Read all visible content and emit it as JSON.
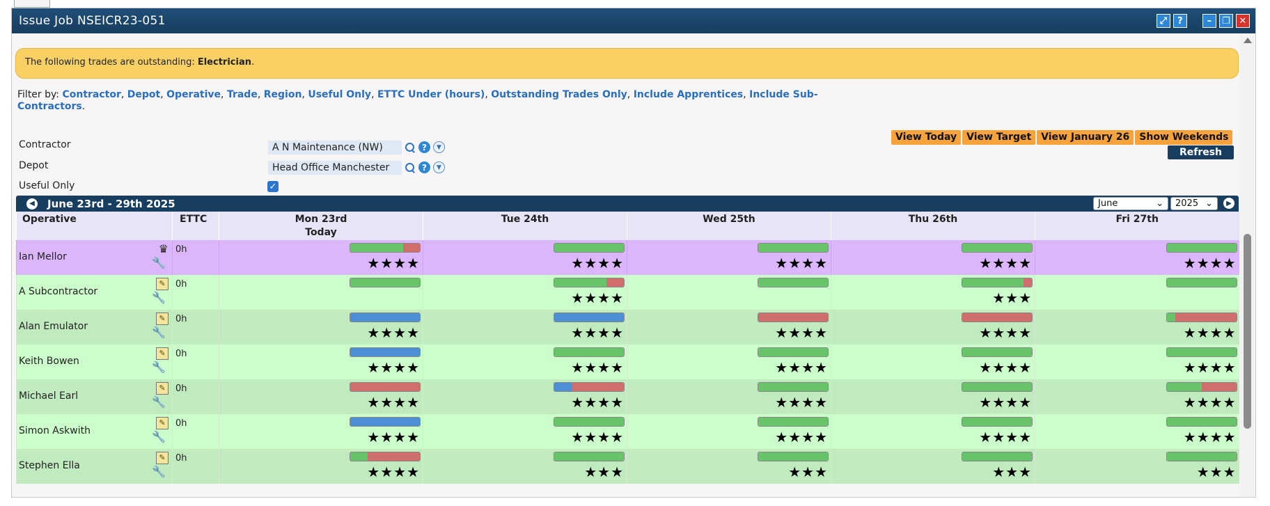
{
  "window": {
    "title": "Issue Job NSEICR23-051",
    "icons": [
      "resize-icon",
      "help-icon",
      "minimize-icon",
      "restore-icon",
      "close-icon"
    ]
  },
  "notice": {
    "prefix": "The following trades are outstanding: ",
    "trade": "Electrician",
    "suffix": "."
  },
  "filter": {
    "label": "Filter by: ",
    "links": [
      "Contractor",
      "Depot",
      "Operative",
      "Trade",
      "Region",
      "Useful Only",
      "ETTC Under (hours)",
      "Outstanding Trades Only",
      "Include Apprentices",
      "Include Sub-Contractors"
    ],
    "end": "."
  },
  "form": {
    "contractor_label": "Contractor",
    "contractor_value": "A N Maintenance (NW)",
    "depot_label": "Depot",
    "depot_value": "Head Office Manchester",
    "useful_label": "Useful Only",
    "useful_checked": true
  },
  "buttons": {
    "view_today": "View Today",
    "view_target": "View Target",
    "view_month": "View January 26",
    "show_weekends": "Show Weekends",
    "refresh": "Refresh"
  },
  "calendar": {
    "range": "June 23rd - 29th 2025",
    "month_select": "June",
    "year_select": "2025",
    "col_operative": "Operative",
    "col_ettc": "ETTC",
    "days": [
      "Mon 23rd",
      "Tue 24th",
      "Wed 25th",
      "Thu 26th",
      "Fri 27th"
    ],
    "today_label": "Today",
    "today_index": 0
  },
  "colors": {
    "green": "#67c46b",
    "blue": "#4d8fd4",
    "red": "#cf6e6a",
    "purple_row": "#dcb6fa",
    "green_row": "#ccfecb"
  },
  "operatives": [
    {
      "name": "Ian Mellor",
      "ettc": "0h",
      "icon": "crown-icon",
      "wrench": "orange",
      "rowclass": "purple",
      "days": [
        {
          "bar": [
            [
              "g",
              76
            ],
            [
              "r",
              24
            ]
          ],
          "stars": "★★★★"
        },
        {
          "bar": [
            [
              "g",
              100
            ]
          ],
          "stars": "★★★★"
        },
        {
          "bar": [
            [
              "g",
              100
            ]
          ],
          "stars": "★★★★"
        },
        {
          "bar": [
            [
              "g",
              100
            ]
          ],
          "stars": "★★★★"
        },
        {
          "bar": [
            [
              "g",
              100
            ]
          ],
          "stars": "★★★★"
        }
      ]
    },
    {
      "name": "A Subcontractor",
      "ettc": "0h",
      "icon": "document-icon",
      "wrench": "blue",
      "rowclass": "g1",
      "days": [
        {
          "bar": [
            [
              "g",
              100
            ]
          ],
          "stars": ""
        },
        {
          "bar": [
            [
              "g",
              75
            ],
            [
              "r",
              25
            ]
          ],
          "stars": "★★★★"
        },
        {
          "bar": [
            [
              "g",
              100
            ]
          ],
          "stars": ""
        },
        {
          "bar": [
            [
              "g",
              88
            ],
            [
              "r",
              12
            ]
          ],
          "stars": "★★★"
        },
        {
          "bar": [
            [
              "g",
              100
            ]
          ],
          "stars": ""
        }
      ]
    },
    {
      "name": "Alan Emulator",
      "ettc": "0h",
      "icon": "document-icon",
      "wrench": "blue",
      "rowclass": "g2",
      "days": [
        {
          "bar": [
            [
              "b",
              100
            ]
          ],
          "stars": "★★★★"
        },
        {
          "bar": [
            [
              "b",
              100
            ]
          ],
          "stars": "★★★★"
        },
        {
          "bar": [
            [
              "r",
              100
            ]
          ],
          "stars": "★★★★"
        },
        {
          "bar": [
            [
              "r",
              100
            ]
          ],
          "stars": "★★★★"
        },
        {
          "bar": [
            [
              "g",
              12
            ],
            [
              "r",
              88
            ]
          ],
          "stars": "★★★★"
        }
      ]
    },
    {
      "name": "Keith Bowen",
      "ettc": "0h",
      "icon": "document-icon",
      "wrench": "blue",
      "rowclass": "g1",
      "days": [
        {
          "bar": [
            [
              "b",
              100
            ]
          ],
          "stars": "★★★★"
        },
        {
          "bar": [
            [
              "g",
              100
            ]
          ],
          "stars": "★★★★"
        },
        {
          "bar": [
            [
              "g",
              100
            ]
          ],
          "stars": "★★★★"
        },
        {
          "bar": [
            [
              "g",
              100
            ]
          ],
          "stars": "★★★★"
        },
        {
          "bar": [
            [
              "g",
              100
            ]
          ],
          "stars": "★★★★"
        }
      ]
    },
    {
      "name": "Michael Earl",
      "ettc": "0h",
      "icon": "document-icon",
      "wrench": "orange",
      "rowclass": "g2",
      "days": [
        {
          "bar": [
            [
              "r",
              100
            ]
          ],
          "stars": "★★★★"
        },
        {
          "bar": [
            [
              "b",
              25
            ],
            [
              "r",
              75
            ]
          ],
          "stars": "★★★★"
        },
        {
          "bar": [
            [
              "g",
              100
            ]
          ],
          "stars": "★★★★"
        },
        {
          "bar": [
            [
              "g",
              100
            ]
          ],
          "stars": "★★★★"
        },
        {
          "bar": [
            [
              "g",
              50
            ],
            [
              "r",
              50
            ]
          ],
          "stars": "★★★★"
        }
      ]
    },
    {
      "name": "Simon Askwith",
      "ettc": "0h",
      "icon": "document-icon",
      "wrench": "orange",
      "rowclass": "g1",
      "days": [
        {
          "bar": [
            [
              "b",
              100
            ]
          ],
          "stars": "★★★★"
        },
        {
          "bar": [
            [
              "g",
              100
            ]
          ],
          "stars": "★★★★"
        },
        {
          "bar": [
            [
              "g",
              100
            ]
          ],
          "stars": "★★★★"
        },
        {
          "bar": [
            [
              "g",
              100
            ]
          ],
          "stars": "★★★★"
        },
        {
          "bar": [
            [
              "g",
              100
            ]
          ],
          "stars": "★★★★"
        }
      ]
    },
    {
      "name": "Stephen Ella",
      "ettc": "0h",
      "icon": "document-icon",
      "wrench": "blue",
      "rowclass": "g2",
      "days": [
        {
          "bar": [
            [
              "g",
              25
            ],
            [
              "r",
              75
            ]
          ],
          "stars": "★★★★"
        },
        {
          "bar": [
            [
              "g",
              100
            ]
          ],
          "stars": "★★★"
        },
        {
          "bar": [
            [
              "g",
              100
            ]
          ],
          "stars": "★★★"
        },
        {
          "bar": [
            [
              "g",
              100
            ]
          ],
          "stars": "★★★"
        },
        {
          "bar": [
            [
              "g",
              100
            ]
          ],
          "stars": "★★★"
        }
      ]
    }
  ]
}
